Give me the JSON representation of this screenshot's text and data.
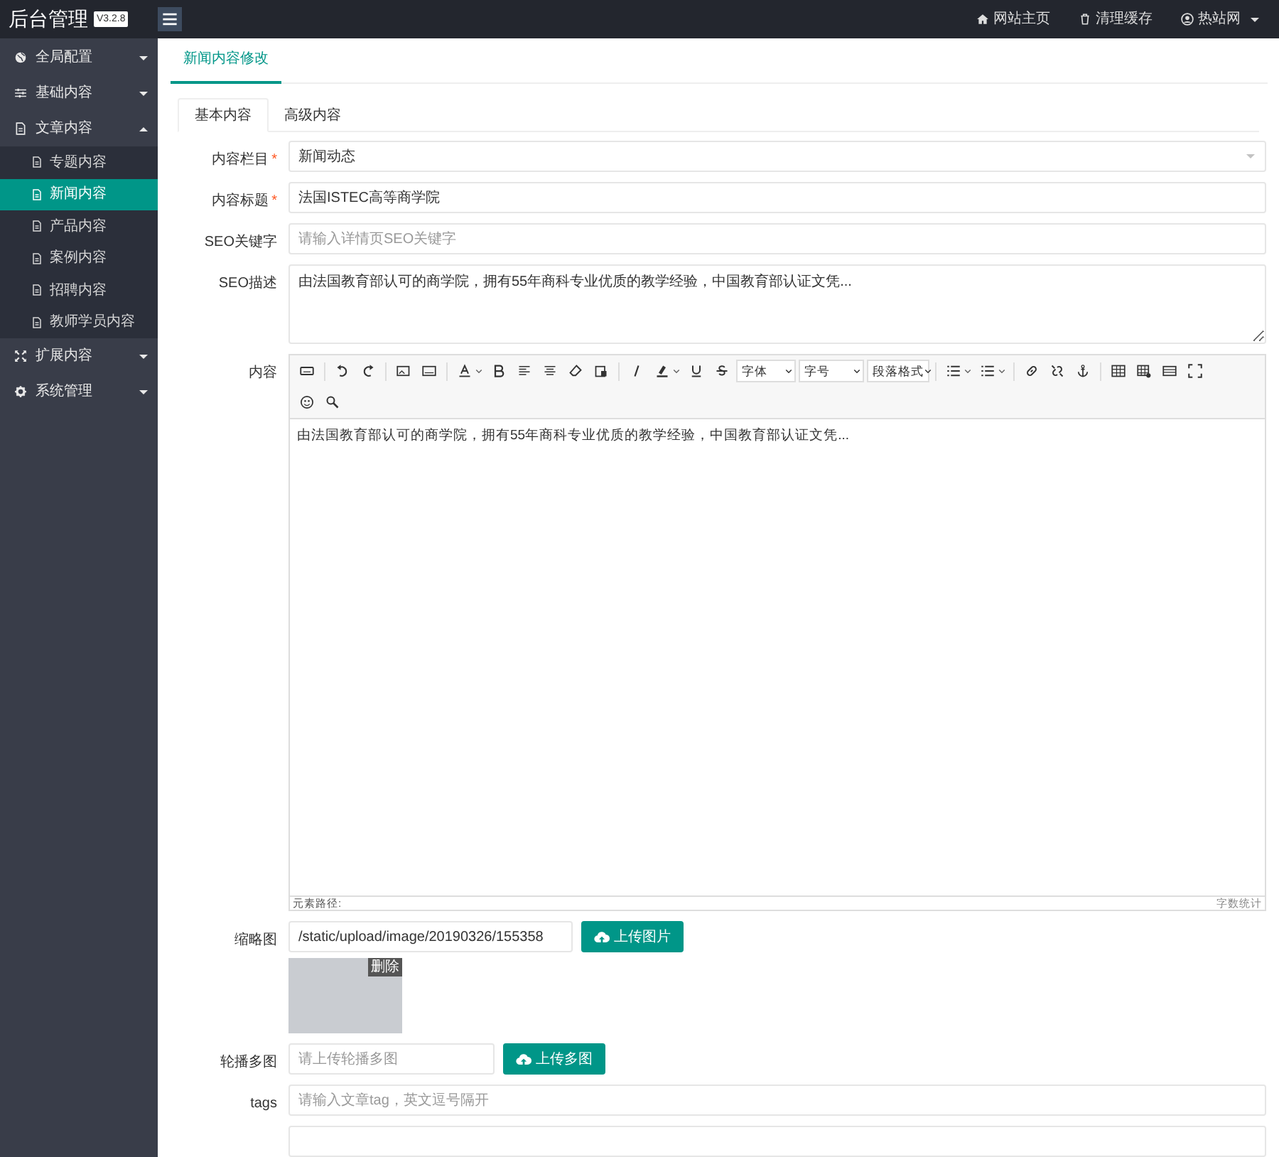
{
  "header": {
    "logo": "后台管理",
    "version": "V3.2.8",
    "links": [
      {
        "kind": "home",
        "label": "网站主页"
      },
      {
        "kind": "trash",
        "label": "清理缓存"
      },
      {
        "kind": "user",
        "label": "热站网",
        "dropdown": true
      }
    ]
  },
  "sidebar": {
    "items": [
      {
        "kind": "globe",
        "label": "全局配置",
        "expanded": false
      },
      {
        "kind": "sliders",
        "label": "基础内容",
        "expanded": false
      },
      {
        "kind": "doc",
        "label": "文章内容",
        "expanded": true,
        "children": [
          {
            "label": "专题内容",
            "selected": false
          },
          {
            "label": "新闻内容",
            "selected": true
          },
          {
            "label": "产品内容",
            "selected": false
          },
          {
            "label": "案例内容",
            "selected": false
          },
          {
            "label": "招聘内容",
            "selected": false
          },
          {
            "label": "教师学员内容",
            "selected": false
          }
        ]
      },
      {
        "kind": "expand",
        "label": "扩展内容",
        "expanded": false
      },
      {
        "kind": "gear",
        "label": "系统管理",
        "expanded": false
      }
    ]
  },
  "page_tab": "新闻内容修改",
  "tabs": [
    {
      "label": "基本内容",
      "selected": true
    },
    {
      "label": "高级内容",
      "selected": false
    }
  ],
  "form": [
    {
      "kind": "select",
      "label": "内容栏目",
      "required_mark": "*",
      "value": "新闻动态"
    },
    {
      "kind": "text",
      "label": "内容标题",
      "required_mark": "*",
      "value": "法国ISTEC高等商学院"
    },
    {
      "kind": "text",
      "label": "SEO关键字",
      "placeholder": "请输入详情页SEO关键字"
    },
    {
      "kind": "textarea",
      "label": "SEO描述",
      "value": "由法国教育部认可的商学院，拥有55年商科专业优质的教学经验，中国教育部认证文凭..."
    },
    {
      "kind": "editor",
      "label": "内容",
      "selects": [
        "字体",
        "字号",
        "段落格式"
      ],
      "value": "由法国教育部认可的商学院，拥有55年商科专业优质的教学经验，中国教育部认证文凭...",
      "path_label": "元素路径:",
      "count_label": "字数统计"
    },
    {
      "kind": "upload",
      "label": "缩略图",
      "value": "/static/upload/image/20190326/155358",
      "button": "上传图片",
      "delete": "删除"
    },
    {
      "kind": "upload",
      "label": "轮播多图",
      "placeholder": "请上传轮播多图",
      "button": "上传多图"
    },
    {
      "kind": "text",
      "label": "tags",
      "placeholder": "请输入文章tag，英文逗号隔开"
    }
  ]
}
